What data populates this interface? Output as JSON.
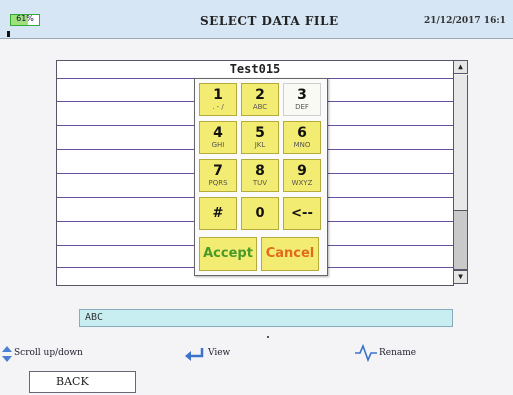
{
  "status": {
    "battery_percent": 61,
    "battery_label": "61%",
    "title": "SELECT DATA FILE",
    "datetime": "21/12/2017 16:1"
  },
  "file_list": {
    "header": "Test015"
  },
  "keypad": {
    "keys": [
      {
        "num": "1",
        "sub": ". - /"
      },
      {
        "num": "2",
        "sub": "ABC"
      },
      {
        "num": "3",
        "sub": "DEF"
      },
      {
        "num": "4",
        "sub": "GHI"
      },
      {
        "num": "5",
        "sub": "JKL"
      },
      {
        "num": "6",
        "sub": "MNO"
      },
      {
        "num": "7",
        "sub": "PQRS"
      },
      {
        "num": "8",
        "sub": "TUV"
      },
      {
        "num": "9",
        "sub": "WXYZ"
      }
    ],
    "hash": "#",
    "zero": "0",
    "backspace": "<--",
    "accept": "Accept",
    "cancel": "Cancel"
  },
  "input": {
    "value": "ABC"
  },
  "hints": {
    "scroll": "Scroll up/down",
    "view": "View",
    "rename": "Rename"
  },
  "back_label": "BACK",
  "colors": {
    "key_yellow": "#f3ec72",
    "accept_green": "#4a9a2a",
    "cancel_orange": "#e36a1a",
    "input_cyan": "#c8eef2",
    "list_line": "#6a4ea0"
  }
}
